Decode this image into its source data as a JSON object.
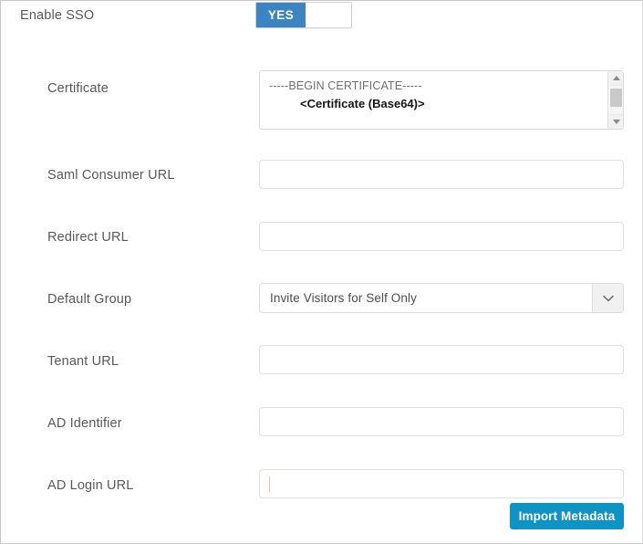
{
  "sso": {
    "label": "Enable SSO",
    "toggle_on_label": "YES",
    "toggle_state": "YES"
  },
  "fields": {
    "certificate": {
      "label": "Certificate",
      "line1": "-----BEGIN CERTIFICATE-----",
      "line2": "<Certificate (Base64)>"
    },
    "saml_consumer_url": {
      "label": "Saml Consumer URL",
      "value": "",
      "placeholder": ""
    },
    "redirect_url": {
      "label": "Redirect URL",
      "value": "",
      "placeholder": ""
    },
    "default_group": {
      "label": "Default Group",
      "selected": "Invite Visitors for Self Only"
    },
    "tenant_url": {
      "label": "Tenant URL",
      "value": "",
      "placeholder": ""
    },
    "ad_identifier": {
      "label": "AD Identifier",
      "value": "",
      "placeholder": ""
    },
    "ad_login_url": {
      "label": "AD Login URL",
      "value": "",
      "placeholder": ""
    }
  },
  "actions": {
    "import_metadata": "Import Metadata"
  },
  "colors": {
    "toggle_on": "#3b85c2",
    "primary_button": "#0e93c4",
    "label_text": "#58595b",
    "input_border": "#dfe0e1",
    "caret": "#f3c77a"
  }
}
